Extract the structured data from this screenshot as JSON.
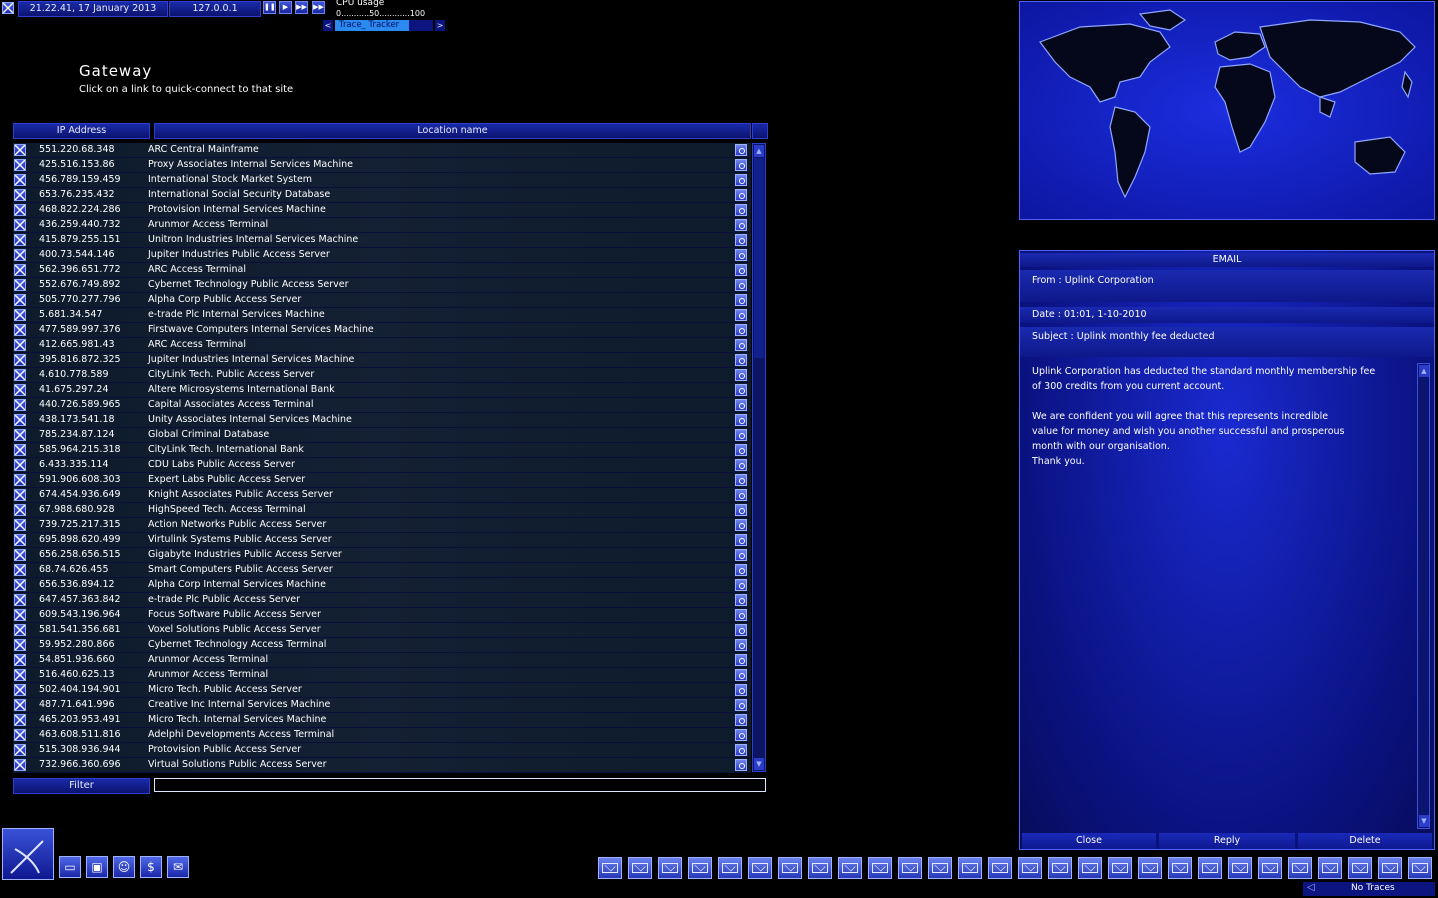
{
  "topbar": {
    "datetime": "21.22.41, 17 January 2013",
    "ip": "127.0.0.1",
    "cpu_label": "CPU usage",
    "cpu_scale": "0...........50............100",
    "tracker_prev": "<",
    "tracker_label": "Trace_ Tracker",
    "tracker_next": ">"
  },
  "gateway": {
    "title": "Gateway",
    "subtitle": "Click on a link to quick-connect to that site",
    "col_ip": "IP Address",
    "col_location": "Location name",
    "filter_label": "Filter",
    "filter_value": "",
    "rows": [
      {
        "ip": "551.220.68.348",
        "loc": "ARC Central Mainframe"
      },
      {
        "ip": "425.516.153.86",
        "loc": "Proxy Associates Internal Services Machine"
      },
      {
        "ip": "456.789.159.459",
        "loc": "International Stock Market System"
      },
      {
        "ip": "653.76.235.432",
        "loc": "International Social Security Database"
      },
      {
        "ip": "468.822.224.286",
        "loc": "Protovision Internal Services Machine"
      },
      {
        "ip": "436.259.440.732",
        "loc": "Arunmor Access Terminal"
      },
      {
        "ip": "415.879.255.151",
        "loc": "Unitron Industries Internal Services Machine"
      },
      {
        "ip": "400.73.544.146",
        "loc": "Jupiter Industries Public Access Server"
      },
      {
        "ip": "562.396.651.772",
        "loc": "ARC Access Terminal"
      },
      {
        "ip": "552.676.749.892",
        "loc": "Cybernet Technology Public Access Server"
      },
      {
        "ip": "505.770.277.796",
        "loc": "Alpha Corp Public Access Server"
      },
      {
        "ip": "5.681.34.547",
        "loc": "e-trade Plc Internal Services Machine"
      },
      {
        "ip": "477.589.997.376",
        "loc": "Firstwave Computers Internal Services Machine"
      },
      {
        "ip": "412.665.981.43",
        "loc": "ARC Access Terminal"
      },
      {
        "ip": "395.816.872.325",
        "loc": "Jupiter Industries Internal Services Machine"
      },
      {
        "ip": "4.610.778.589",
        "loc": "CityLink Tech. Public Access Server"
      },
      {
        "ip": "41.675.297.24",
        "loc": "Altere Microsystems International Bank"
      },
      {
        "ip": "440.726.589.965",
        "loc": "Capital Associates Access Terminal"
      },
      {
        "ip": "438.173.541.18",
        "loc": "Unity Associates Internal Services Machine"
      },
      {
        "ip": "785.234.87.124",
        "loc": "Global Criminal Database"
      },
      {
        "ip": "585.964.215.318",
        "loc": "CityLink Tech. International Bank"
      },
      {
        "ip": "6.433.335.114",
        "loc": "CDU Labs Public Access Server"
      },
      {
        "ip": "591.906.608.303",
        "loc": "Expert Labs Public Access Server"
      },
      {
        "ip": "674.454.936.649",
        "loc": "Knight Associates Public Access Server"
      },
      {
        "ip": "67.988.680.928",
        "loc": "HighSpeed Tech. Access Terminal"
      },
      {
        "ip": "739.725.217.315",
        "loc": "Action Networks Public Access Server"
      },
      {
        "ip": "695.898.620.499",
        "loc": "Virtulink Systems Public Access Server"
      },
      {
        "ip": "656.258.656.515",
        "loc": "Gigabyte Industries Public Access Server"
      },
      {
        "ip": "68.74.626.455",
        "loc": "Smart Computers Public Access Server"
      },
      {
        "ip": "656.536.894.12",
        "loc": "Alpha Corp Internal Services Machine"
      },
      {
        "ip": "647.457.363.842",
        "loc": "e-trade Plc Public Access Server"
      },
      {
        "ip": "609.543.196.964",
        "loc": "Focus Software Public Access Server"
      },
      {
        "ip": "581.541.356.681",
        "loc": "Voxel Solutions Public Access Server"
      },
      {
        "ip": "59.952.280.866",
        "loc": "Cybernet Technology Access Terminal"
      },
      {
        "ip": "54.851.936.660",
        "loc": "Arunmor Access Terminal"
      },
      {
        "ip": "516.460.625.13",
        "loc": "Arunmor Access Terminal"
      },
      {
        "ip": "502.404.194.901",
        "loc": "Micro Tech. Public Access Server"
      },
      {
        "ip": "487.71.641.996",
        "loc": "Creative Inc Internal Services Machine"
      },
      {
        "ip": "465.203.953.491",
        "loc": "Micro Tech. Internal Services Machine"
      },
      {
        "ip": "463.608.511.816",
        "loc": "Adelphi Developments Access Terminal"
      },
      {
        "ip": "515.308.936.944",
        "loc": "Protovision Public Access Server"
      },
      {
        "ip": "732.966.360.696",
        "loc": "Virtual Solutions Public Access Server"
      }
    ]
  },
  "email": {
    "header": "EMAIL",
    "from": "From : Uplink Corporation",
    "date": "Date : 01:01, 1-10-2010",
    "subject": "Subject : Uplink monthly fee deducted",
    "body": [
      "Uplink Corporation has deducted the standard monthly membership fee",
      "of 300 credits from you current account.",
      "",
      "We are confident you will agree that this represents incredible",
      "value for money and wish you another successful and prosperous",
      "month with our organisation.",
      "Thank you."
    ],
    "close": "Close",
    "reply": "Reply",
    "delete": "Delete"
  },
  "status": {
    "traces": "No Traces"
  },
  "mail_icon_count": 28,
  "colors": {
    "accent": "#1a2ad0",
    "background": "#000000",
    "row_bg": "#142033"
  }
}
